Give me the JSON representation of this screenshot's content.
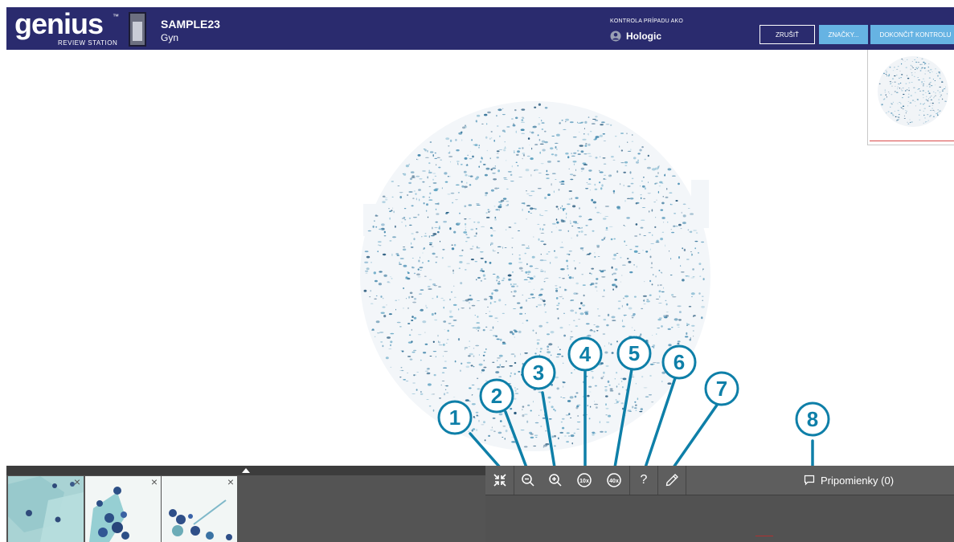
{
  "header": {
    "logo_text": "genius",
    "logo_tm": "™",
    "logo_sub": "REVIEW STATION",
    "case_id": "SAMPLE23",
    "case_type": "Gyn",
    "review_label": "KONTROLA PRÍPADU AKO",
    "user_name": "Hologic",
    "buttons": {
      "cancel": "ZRUŠIŤ",
      "marks": "ZNAČKY...",
      "finish": "DOKONČIŤ KONTROLU"
    }
  },
  "toolbar": {
    "tools": [
      {
        "icon": "fit-to-screen-icon",
        "callout": "1"
      },
      {
        "icon": "zoom-out-icon",
        "callout": "2"
      },
      {
        "icon": "zoom-in-icon",
        "callout": "3"
      },
      {
        "icon": "zoom-10x-icon",
        "label": "10x",
        "callout": "4"
      },
      {
        "icon": "zoom-40x-icon",
        "label": "40x",
        "callout": "5"
      },
      {
        "icon": "help-icon",
        "label": "?",
        "callout": "6"
      },
      {
        "icon": "pen-icon",
        "callout": "7"
      }
    ],
    "comments_label": "Pripomienky (0)",
    "comments_callout": "8"
  },
  "thumbnails": [
    {
      "close": "×"
    },
    {
      "close": "×"
    },
    {
      "close": "×"
    }
  ],
  "colors": {
    "header_bg": "#2a2b6e",
    "button_accent": "#66b3e3",
    "callout": "#0e7fa8",
    "panel_bg": "#545454"
  }
}
